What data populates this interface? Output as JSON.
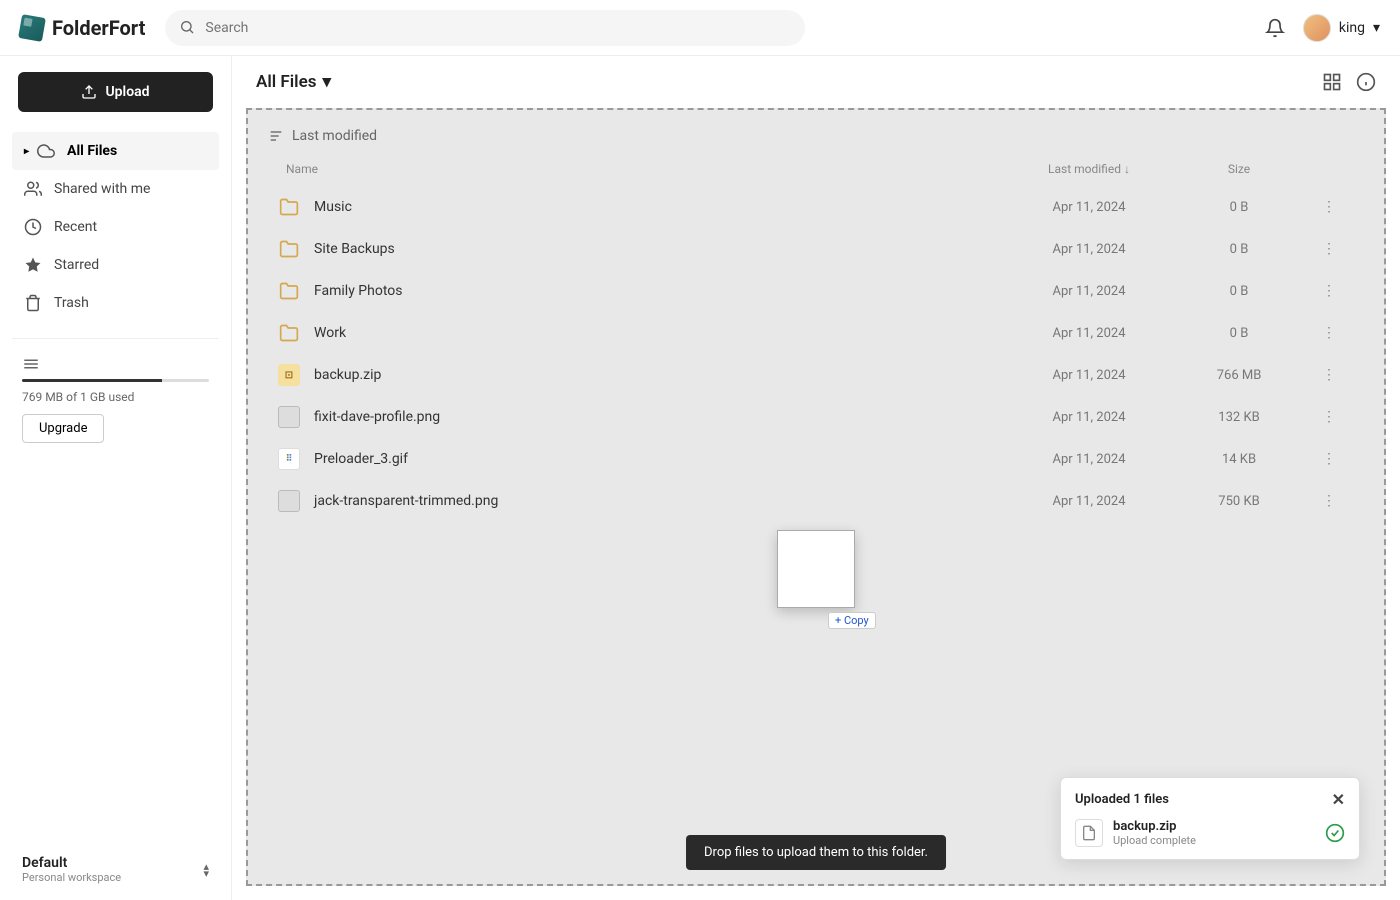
{
  "app": {
    "name": "FolderFort"
  },
  "search": {
    "placeholder": "Search"
  },
  "user": {
    "name": "king"
  },
  "sidebar": {
    "upload_label": "Upload",
    "items": [
      {
        "label": "All Files"
      },
      {
        "label": "Shared with me"
      },
      {
        "label": "Recent"
      },
      {
        "label": "Starred"
      },
      {
        "label": "Trash"
      }
    ],
    "storage": {
      "text": "769 MB of 1 GB used",
      "percent": 75
    },
    "upgrade_label": "Upgrade",
    "workspace": {
      "name": "Default",
      "subtitle": "Personal workspace"
    }
  },
  "main": {
    "title": "All Files",
    "sort_label": "Last modified",
    "columns": {
      "name": "Name",
      "modified": "Last modified",
      "size": "Size"
    },
    "rows": [
      {
        "type": "folder",
        "name": "Music",
        "modified": "Apr 11, 2024",
        "size": "0 B"
      },
      {
        "type": "folder",
        "name": "Site Backups",
        "modified": "Apr 11, 2024",
        "size": "0 B"
      },
      {
        "type": "folder",
        "name": "Family Photos",
        "modified": "Apr 11, 2024",
        "size": "0 B"
      },
      {
        "type": "folder",
        "name": "Work",
        "modified": "Apr 11, 2024",
        "size": "0 B"
      },
      {
        "type": "zip",
        "name": "backup.zip",
        "modified": "Apr 11, 2024",
        "size": "766 MB"
      },
      {
        "type": "image",
        "name": "fixit-dave-profile.png",
        "modified": "Apr 11, 2024",
        "size": "132 KB"
      },
      {
        "type": "preloader",
        "name": "Preloader_3.gif",
        "modified": "Apr 11, 2024",
        "size": "14 KB"
      },
      {
        "type": "image",
        "name": "jack-transparent-trimmed.png",
        "modified": "Apr 11, 2024",
        "size": "750 KB"
      }
    ],
    "copy_badge": "+ Copy",
    "drop_hint": "Drop files to upload them to this folder."
  },
  "toast": {
    "title": "Uploaded 1 files",
    "file": {
      "name": "backup.zip",
      "status": "Upload complete"
    }
  }
}
